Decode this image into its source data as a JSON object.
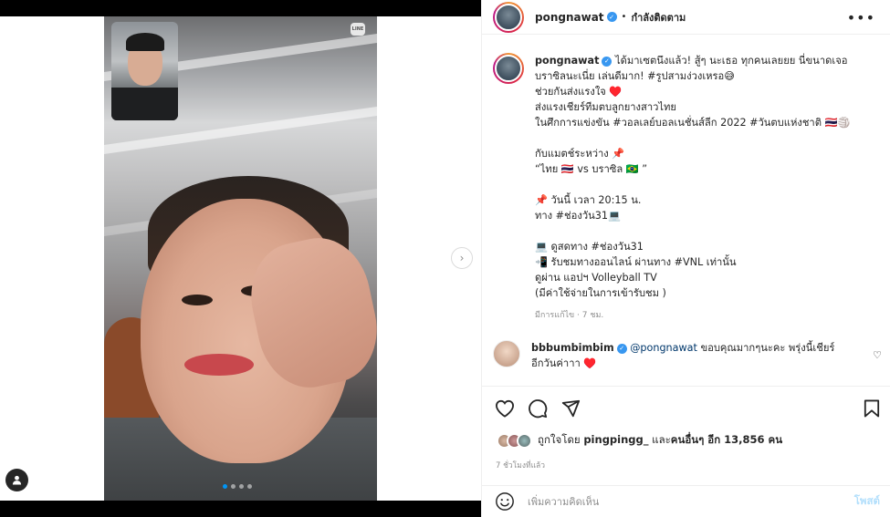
{
  "header": {
    "username": "pongnawat",
    "separator": "•",
    "follow_status": "กำลังติดตาม",
    "more": "•••"
  },
  "media": {
    "line_badge": "LINE",
    "next_arrow": "›",
    "slide_count": 4,
    "active_slide": 1
  },
  "caption": {
    "username": "pongnawat",
    "lines": [
      "ได้มาเซตนึงแล้ว! สู้ๆ นะเธอ ทุกคนเลยยย นี่ขนาดเจอ",
      "บราซิลนะเนี่ย เล่นดีมาก! #รูปสามง่วงเหรอ😅",
      "ช่วยกันส่งแรงใจ ♥️",
      "ส่งแรงเชียร์ทีมตบลูกยางสาวไทย",
      "ในศึกการแข่งขัน #วอลเลย์บอลเนชั่นส์ลีก 2022 #วันตบแห่งชาติ 🇹🇭🏐",
      "",
      "กับแมตช์ระหว่าง 📌",
      "“ไทย 🇹🇭 vs บราซิล 🇧🇷 ”",
      "",
      "📌 วันนี้ เวลา 20:15 น.",
      "ทาง #ช่องวัน31💻",
      "",
      "💻 ดูสดทาง #ช่องวัน31",
      "📲 รับชมทางออนไลน์ ผ่านทาง #VNL เท่านั้น",
      "ดูผ่าน แอปฯ Volleyball TV",
      "(มีค่าใช้จ่ายในการเข้ารับชม )"
    ],
    "meta": "มีการแก้ไข · 7 ชม."
  },
  "comment": {
    "username": "bbbumbimbim",
    "mention": "@pongnawat",
    "text": " ขอบคุณมากๆนะคะ พรุ่งนี้เชียร์",
    "text2": "อีกวันค่าาา ♥️"
  },
  "likes": {
    "prefix": "ถูกใจโดย ",
    "liker": "pingpingg_",
    "middle": " และ",
    "others": "คนอื่นๆ อีก 13,856 คน"
  },
  "timestamp": "7 ชั่วโมงที่แล้ว",
  "add_comment": {
    "placeholder": "เพิ่มความคิดเห็น",
    "post_label": "โพสต์"
  }
}
